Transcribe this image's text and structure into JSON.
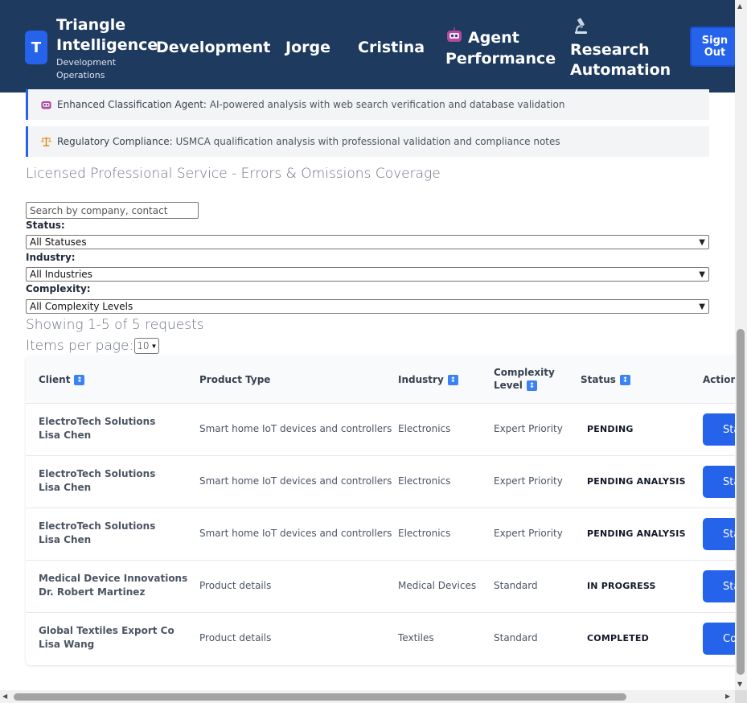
{
  "header": {
    "logo_letter": "T",
    "brand_title_line1": "Triangle",
    "brand_title_line2": "Intelligence",
    "brand_sub_line1": "Development",
    "brand_sub_line2": "Operations",
    "nav": [
      {
        "label": "Development"
      },
      {
        "label": "Jorge"
      },
      {
        "label": "Cristina"
      },
      {
        "label_line1": "Agent",
        "label_line2": "Performance",
        "icon": "robot-icon"
      },
      {
        "label_line1": "Research",
        "label_line2": "Automation",
        "icon": "microscope-icon"
      }
    ],
    "signout_line1": "Sign",
    "signout_line2": "Out",
    "colors": {
      "navy": "#1e3a5f",
      "accent": "#2563eb"
    }
  },
  "banners": [
    {
      "icon": "robot-icon",
      "name": "Enhanced Classification Agent:",
      "text": "AI-powered analysis with web search verification and database validation"
    },
    {
      "icon": "scales-icon",
      "name": "Regulatory Compliance:",
      "text": "USMCA qualification analysis with professional validation and compliance notes"
    }
  ],
  "section_title": "Licensed Professional Service - Errors & Omissions Coverage",
  "filters": {
    "search_placeholder": "Search by company, contact",
    "status_label": "Status:",
    "status_value": "All Statuses",
    "industry_label": "Industry:",
    "industry_value": "All Industries",
    "complexity_label": "Complexity:",
    "complexity_value": "All Complexity Levels"
  },
  "pagination": {
    "showing": "Showing 1-5 of 5 requests",
    "per_page_label": "Items per page:",
    "per_page_value": "10"
  },
  "table": {
    "headers": {
      "client": "Client",
      "product": "Product Type",
      "industry": "Industry",
      "complexity_line1": "Complexity",
      "complexity_line2": "Level",
      "status": "Status",
      "actions": "Actions"
    },
    "rows": [
      {
        "client": "ElectroTech Solutions",
        "contact": "Lisa Chen",
        "product": "Smart home IoT devices and controllers",
        "industry": "Electronics",
        "complexity": "Expert Priority",
        "status": "PENDING",
        "action": "Start"
      },
      {
        "client": "ElectroTech Solutions",
        "contact": "Lisa Chen",
        "product": "Smart home IoT devices and controllers",
        "industry": "Electronics",
        "complexity": "Expert Priority",
        "status": "PENDING ANALYSIS",
        "action": "Start"
      },
      {
        "client": "ElectroTech Solutions",
        "contact": "Lisa Chen",
        "product": "Smart home IoT devices and controllers",
        "industry": "Electronics",
        "complexity": "Expert Priority",
        "status": "PENDING ANALYSIS",
        "action": "Start"
      },
      {
        "client": "Medical Device Innovations",
        "contact": "Dr. Robert Martinez",
        "product": "Product details",
        "industry": "Medical Devices",
        "complexity": "Standard",
        "status": "IN PROGRESS",
        "action": "Start"
      },
      {
        "client": "Global Textiles Export Co",
        "contact": "Lisa Wang",
        "product": "Product details",
        "industry": "Textiles",
        "complexity": "Standard",
        "status": "COMPLETED",
        "action": "Continue"
      }
    ]
  }
}
